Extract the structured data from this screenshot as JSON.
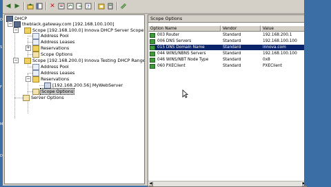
{
  "toolbar": {
    "buttons": [
      "back-icon",
      "forward-icon",
      "up-icon",
      "show-hide-tree-icon",
      "delete-icon",
      "properties-icon",
      "refresh-icon",
      "export-icon",
      "help-icon",
      "new-scope-icon",
      "server-option-icon"
    ]
  },
  "tree": {
    "root": "DHCP",
    "server": "theblack.gateway.com [192.168.100.100]",
    "scope1": {
      "label": "Scope [192.168.100.0] Innova DHCP Server Scope",
      "address_pool": "Address Pool",
      "address_leases": "Address Leases",
      "reservations": "Reservations",
      "scope_options": "Scope Options"
    },
    "scope2": {
      "label": "Scope [192.168.200.0] Innova Testing DHCP Range",
      "address_pool": "Address Pool",
      "address_leases": "Address Leases",
      "reservations": "Reservations",
      "reservation_item": "[192.168.200.56] MyWebServer",
      "scope_options": "Scope Options"
    },
    "server_options": "Server Options"
  },
  "right": {
    "title": "Scope Options",
    "columns": [
      "Option Name",
      "Vendor",
      "Value"
    ],
    "rows": [
      {
        "name": "003 Router",
        "vendor": "Standard",
        "value": "192.168.200.1"
      },
      {
        "name": "006 DNS Servers",
        "vendor": "Standard",
        "value": "192.168.100.100"
      },
      {
        "name": "015 DNS Domain Name",
        "vendor": "Standard",
        "value": "innova.com"
      },
      {
        "name": "044 WINS/NBNS Servers",
        "vendor": "Standard",
        "value": "192.168.100.100"
      },
      {
        "name": "046 WINS/NBT Node Type",
        "vendor": "Standard",
        "value": "0x8"
      },
      {
        "name": "060 PXEClient",
        "vendor": "Standard",
        "value": "PXEClient"
      }
    ],
    "selected_row": 2
  },
  "desktop": {
    "letters": [
      "D",
      "S",
      "F",
      "M",
      "De"
    ]
  },
  "colors": {
    "desktop": "#3a6ea5",
    "selection": "#0a246a",
    "window_face": "#d4d0c8"
  }
}
